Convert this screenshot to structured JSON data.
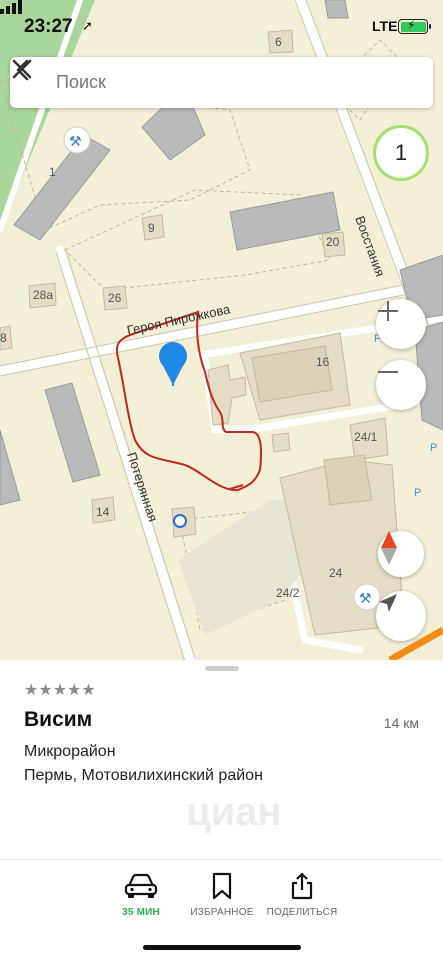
{
  "status_bar": {
    "time": "23:27",
    "network": "LTE"
  },
  "search": {
    "placeholder": "Поиск"
  },
  "map": {
    "street_labels": [
      "Героя Пирожкова",
      "Восстания",
      "Потерянная"
    ],
    "building_numbers": [
      "6",
      "1",
      "9",
      "20",
      "28а",
      "26",
      "8",
      "16",
      "24/1",
      "14",
      "24",
      "24/2"
    ],
    "parking_labels": [
      "P",
      "P",
      "P"
    ],
    "result_count": "1",
    "marker_color": "#1e88e5",
    "outline_color": "#c0281e"
  },
  "controls": {
    "zoom_in": "+",
    "zoom_out": "−"
  },
  "place": {
    "rating_stars": "★★★★★",
    "name": "Висим",
    "distance": "14 км",
    "type": "Микрорайон",
    "address": "Пермь, Мотовилихинский район",
    "watermark": "циан"
  },
  "actions": {
    "route_label": "35 МИН",
    "favorites_label": "ИЗБРАННОЕ",
    "share_label": "ПОДЕЛИТЬСЯ",
    "route_color": "#28b34a"
  }
}
